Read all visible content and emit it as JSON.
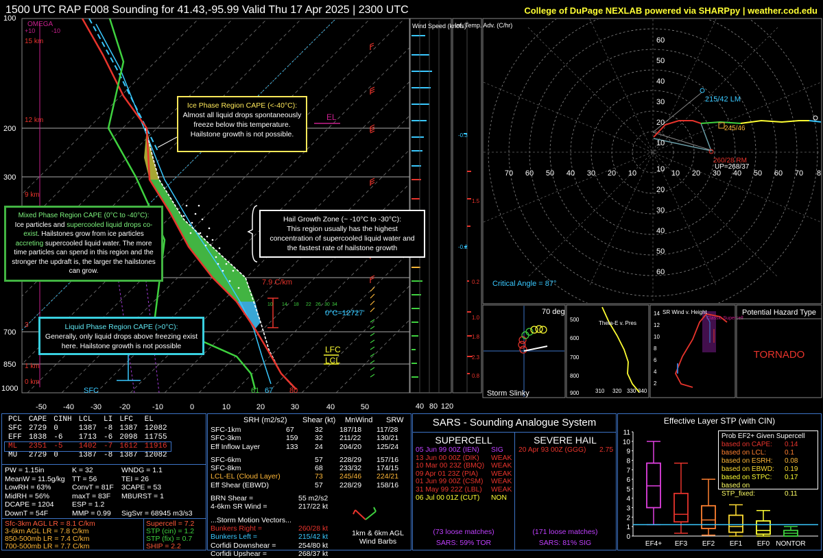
{
  "header": {
    "title": "1500 UTC RAP F008 Sounding for 41.43,-95.99 Valid  Thu 17 Apr 2025 | 2300 UTC",
    "credit": "College of DuPage NEXLAB powered via SHARPpy | weather.cod.edu"
  },
  "skewt": {
    "pressure_labels": [
      "100",
      "200",
      "300",
      "700",
      "850",
      "1000"
    ],
    "temp_labels": [
      "-50",
      "-40",
      "-30",
      "-20",
      "-10",
      "0",
      "10",
      "20",
      "30",
      "40",
      "50"
    ],
    "omega_label": "OMEGA",
    "omega_ticks": [
      "+10",
      "-10"
    ],
    "height_labels": [
      "15 km",
      "12 km",
      "9 km",
      "3",
      "1 km",
      "0 km"
    ],
    "el_label": "EL",
    "lfc_label": "LFC",
    "lcl_label": "LCL",
    "freezing_label": "0°C=12727'",
    "lapse_label": "7.9 C/km",
    "sfc_label": "SFC",
    "sfc_temps": [
      "61",
      "67",
      "80"
    ],
    "hgz_ticks": [
      "10",
      "14",
      "18",
      "22",
      "26",
      "30",
      "34"
    ]
  },
  "callouts": {
    "ice": {
      "title": "Ice Phase Region CAPE (<-40°C):",
      "body": "Almost all liquid drops spontaneously freeze below this temperature. Hailstone growth is not possible."
    },
    "mixed": {
      "title": "Mixed Phase Region CAPE (0°C to -40°C):",
      "p1": "Ice particles and ",
      "p2": "supercooled liquid",
      "p3": "drops ",
      "p4": "co-exist",
      "p5": ". Hailstones grow from ice particles ",
      "p6": "accreting",
      "p7": " supercooled liquid water. The more time particles can spend in this region and the stronger the updraft is, the larger the hailstones can grow."
    },
    "hgz": {
      "title": "Hail Growth Zone (~ -10°C to -30°C):",
      "body": "This region usually has the highest concentration of supercooled liquid water and the fastest rate of hailstone growth"
    },
    "liquid": {
      "title": "Liquid Phase Region CAPE (>0°C):",
      "body": "Generally, only liquid drops above freezing exist here. Hailstone growth is not possible"
    }
  },
  "wind_speed": {
    "title": "Wind Speed (knots)",
    "ticks": [
      "40",
      "80",
      "120"
    ]
  },
  "inf_temp": {
    "title": "Inf. Temp. Adv. (C/hr)",
    "values": [
      "-0.3",
      "1.5",
      "-0.2",
      "0.2",
      "1.0",
      "1.8",
      "2.3",
      "0.8"
    ]
  },
  "hodograph": {
    "rings": [
      "10",
      "20",
      "30",
      "40",
      "50",
      "60"
    ],
    "xlabels": [
      "70",
      "60",
      "50",
      "40",
      "30",
      "20",
      "10",
      "10",
      "20",
      "30",
      "40",
      "50",
      "60",
      "70",
      "8"
    ],
    "lm": "215/42 LM",
    "mean": "245/46",
    "rm": "260/28 RM",
    "up": "UP=268/37",
    "critical_angle": "Critical Angle = 87°"
  },
  "storm_slinky": {
    "label": "Storm Slinky",
    "angle": "70 deg"
  },
  "theta_e": {
    "title": "Theta-E v. Pres",
    "ylabels": [
      "500",
      "600",
      "700",
      "800",
      "900"
    ],
    "xlabels": [
      "310",
      "320",
      "330",
      "340"
    ]
  },
  "sr_wind": {
    "title": "SR Wind v. Height",
    "legend": "Classic Supercell",
    "ylabels": [
      "14",
      "12",
      "10",
      "8",
      "6",
      "4",
      "2"
    ]
  },
  "hazard": {
    "title": "Potential Hazard Type",
    "value": "TORNADO"
  },
  "parcels": {
    "headers": [
      "PCL",
      "CAPE",
      "CINH",
      "LCL",
      "LI",
      "LFC",
      "EL"
    ],
    "rows": [
      [
        "SFC",
        "2729",
        "0",
        "1387",
        "-8",
        "1387",
        "12082"
      ],
      [
        "EFF",
        "1838",
        "-6",
        "1713",
        "-6",
        "2098",
        "11755"
      ],
      [
        "ML",
        "2351",
        "-5",
        "1402",
        "-7",
        "1612",
        "11916"
      ],
      [
        "MU",
        "2729",
        "0",
        "1387",
        "-8",
        "1387",
        "12082"
      ]
    ],
    "indices": [
      [
        "PW = 1.15in",
        "K = 32",
        "WNDG = 1.1"
      ],
      [
        "MeanW = 11.5g/kg",
        "TT = 56",
        "TEI = 26"
      ],
      [
        "LowRH = 63%",
        "ConvT = 81F",
        "3CAPE = 53"
      ],
      [
        "MidRH = 56%",
        "maxT = 83F",
        "MBURST = 1"
      ],
      [
        "DCAPE = 1204",
        "ESP = 1.2",
        ""
      ],
      [
        "DownT = 54F",
        "MMP = 0.99",
        "SigSvr = 68945 m3/s3"
      ]
    ],
    "lapse": [
      "Sfc-3km AGL LR = 8.1 C/km",
      "3-6km AGL LR = 7.8 C/km",
      "850-500mb LR = 7.4 C/km",
      "700-500mb LR = 7.7 C/km"
    ],
    "composite": [
      "Supercell = 7.2",
      "STP (cin) = 1.2",
      "STP (fix) = 0.7",
      "SHIP = 2.2"
    ]
  },
  "kinematics": {
    "headers": [
      "SRH (m2/s2)",
      "Shear (kt)",
      "MnWind",
      "SRW"
    ],
    "rows": [
      [
        "SFC-1km",
        "67",
        "32",
        "187/18",
        "117/28"
      ],
      [
        "SFC-3km",
        "159",
        "32",
        "211/22",
        "130/21"
      ],
      [
        "Eff Inflow Layer",
        "133",
        "24",
        "204/20",
        "125/24"
      ],
      [
        "SFC-6km",
        "",
        "57",
        "228/29",
        "157/16"
      ],
      [
        "SFC-8km",
        "",
        "68",
        "233/32",
        "174/15"
      ],
      [
        "LCL-EL (Cloud Layer)",
        "",
        "73",
        "245/46",
        "224/21"
      ],
      [
        "Eff Shear (EBWD)",
        "",
        "57",
        "228/29",
        "158/16"
      ]
    ],
    "brn": "BRN Shear =",
    "brn_val": "55 m2/s2",
    "sr46": "4-6km SR Wind =",
    "sr46_val": "217/22 kt",
    "vectors_title": "...Storm Motion Vectors...",
    "vectors": [
      [
        "Bunkers Right =",
        "260/28 kt"
      ],
      [
        "Bunkers Left =",
        "215/42 kt"
      ],
      [
        "Corfidi Downshear =",
        "254/80 kt"
      ],
      [
        "Corfidi Upshear =",
        "268/37 kt"
      ]
    ],
    "barbs_label": "1km & 6km AGL Wind Barbs"
  },
  "sars": {
    "title": "SARS - Sounding Analogue System",
    "supercell_title": "SUPERCELL",
    "hail_title": "SEVERE HAIL",
    "supercell": [
      [
        "05 Jun 99 00Z (IEN)",
        "SIG"
      ],
      [
        "13 Jun 00 00Z (DIK)",
        "WEAK"
      ],
      [
        "10 Mar 00 23Z (BMQ)",
        "WEAK"
      ],
      [
        "09 Apr 01 23Z (PIA)",
        "WEAK"
      ],
      [
        "01 Jun 99 00Z (CSM)",
        "WEAK"
      ],
      [
        "31 May 99 22Z (LBL)",
        "WEAK"
      ],
      [
        "06 Jul 00 01Z (CUT)",
        "NON"
      ]
    ],
    "hail": [
      [
        "20 Apr 93 00Z (GGG)",
        "2.75"
      ]
    ],
    "supercell_matches": "(73 loose matches)",
    "hail_matches": "(171 loose matches)",
    "supercell_pct": "SARS: 59% TOR",
    "hail_pct": "SARS: 81% SIG"
  },
  "stp": {
    "title": "Effective Layer STP (with CIN)",
    "yticks": [
      "11",
      "10",
      "9",
      "8",
      "7",
      "6",
      "5",
      "4",
      "3",
      "2",
      "1",
      "0"
    ],
    "categories": [
      "EF4+",
      "EF3",
      "EF2",
      "EF1",
      "EF0",
      "NONTOR"
    ],
    "prob_title": "Prob EF2+ Given Supercell",
    "prob": [
      [
        "based on CAPE:",
        "0.14"
      ],
      [
        "based on LCL:",
        "0.1"
      ],
      [
        "based on ESRH:",
        "0.08"
      ],
      [
        "based on EBWD:",
        "0.19"
      ],
      [
        "based on STPC:",
        "0.17"
      ],
      [
        "based on STP_fixed:",
        "0.11"
      ]
    ]
  },
  "colors": {
    "temp": "#e8342c",
    "dewp": "#3fd23f",
    "parcel": "#ffffff",
    "wetbulb": "#39c8ff",
    "hodo_0_3": "#e8342c",
    "hodo_3_6": "#3fd23f",
    "hodo_6_9": "#ffff33",
    "hodo_9_12": "#39c8ff",
    "panel_border": "#3d74c7",
    "gold": "#ffe95a"
  }
}
